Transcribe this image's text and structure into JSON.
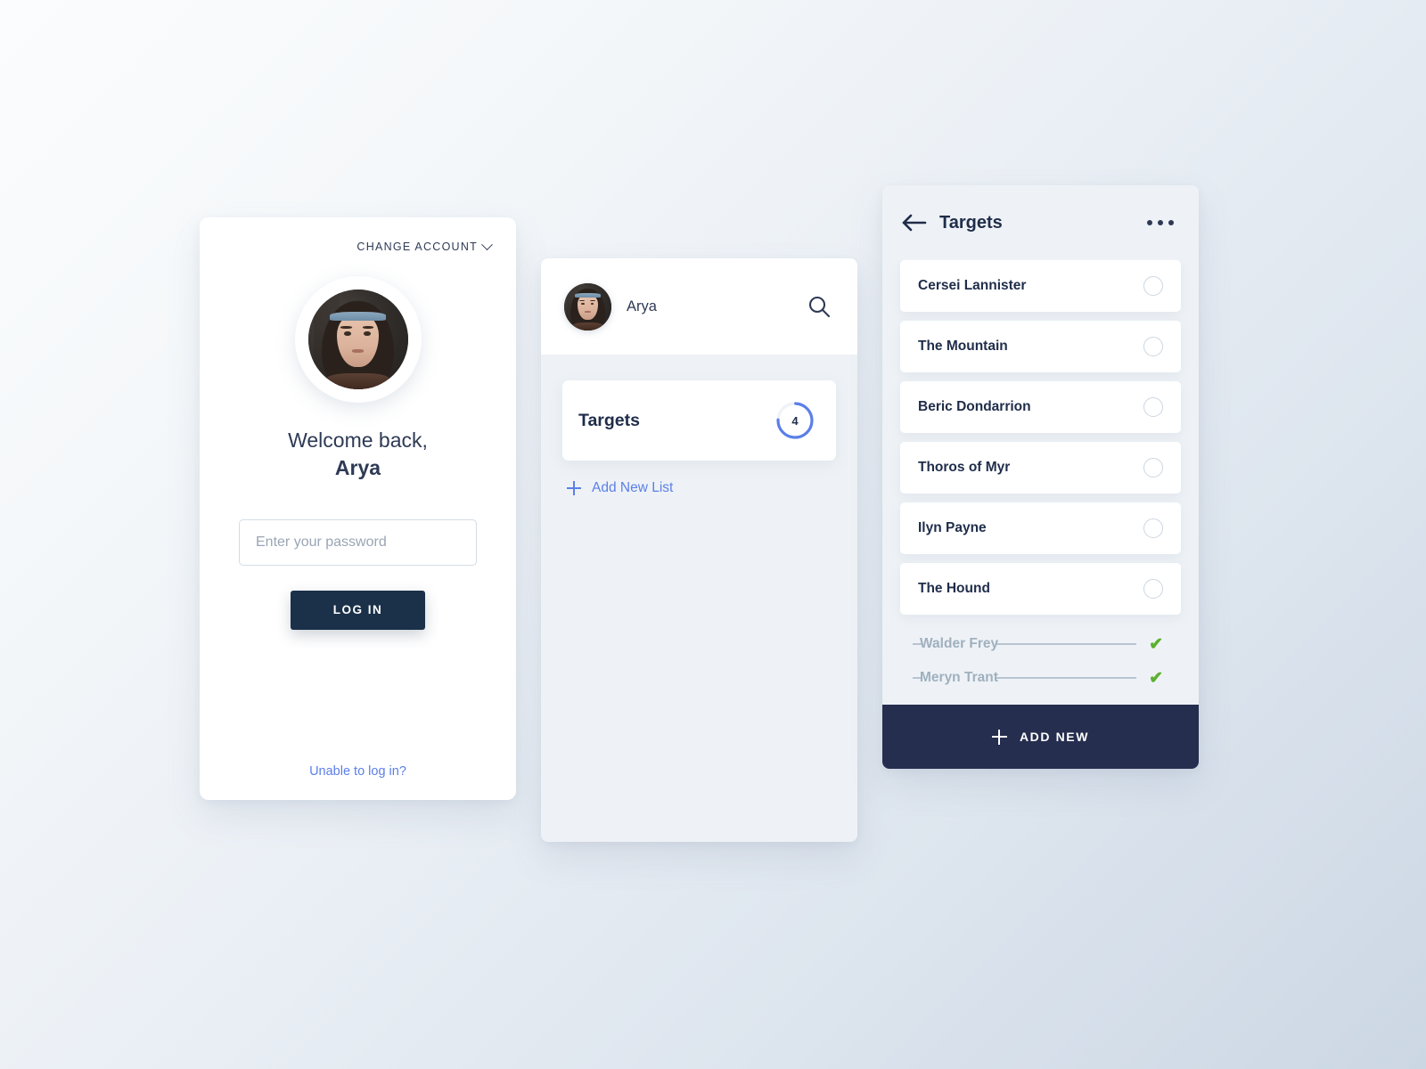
{
  "theme": {
    "navy": "#1f2d4a",
    "navy_button": "#1b3049",
    "navy_footer": "#252e4e",
    "accent_blue": "#5b7fe8",
    "panel_bg": "#eef2f6",
    "card_white": "#ffffff",
    "check_green": "#5cb030",
    "muted_text": "#9fb0bf",
    "bg_gradient_from": "#fbfcfd",
    "bg_gradient_to": "#ccd7e4"
  },
  "login": {
    "change_account_label": "CHANGE ACCOUNT",
    "chevron_icon": "chevron-down-icon",
    "avatar_icon": "avatar",
    "welcome_line": "Welcome back,",
    "user_name": "Arya",
    "password_placeholder": "Enter your password",
    "password_value": "",
    "login_button_label": "LOG IN",
    "unable_login_label": "Unable to log in?"
  },
  "lists": {
    "user_name": "Arya",
    "avatar_icon": "avatar",
    "search_icon": "search-icon",
    "items": [
      {
        "label": "Targets",
        "count": "4",
        "progress_percent": 75
      }
    ],
    "add_new_list_label": "Add New List",
    "add_icon": "plus-icon"
  },
  "targets": {
    "back_icon": "arrow-left-icon",
    "title": "Targets",
    "more_icon": "ellipsis-icon",
    "open_items": [
      {
        "name": "Cersei Lannister",
        "checked": false
      },
      {
        "name": "The Mountain",
        "checked": false
      },
      {
        "name": "Beric Dondarrion",
        "checked": false
      },
      {
        "name": "Thoros of Myr",
        "checked": false
      },
      {
        "name": "Ilyn Payne",
        "checked": false
      },
      {
        "name": "The Hound",
        "checked": false
      }
    ],
    "done_items": [
      {
        "name": "Walder Frey",
        "checked": true,
        "check_glyph": "✔"
      },
      {
        "name": "Meryn Trant",
        "checked": true,
        "check_glyph": "✔"
      }
    ],
    "add_new_label": "ADD NEW",
    "add_icon": "plus-icon"
  }
}
